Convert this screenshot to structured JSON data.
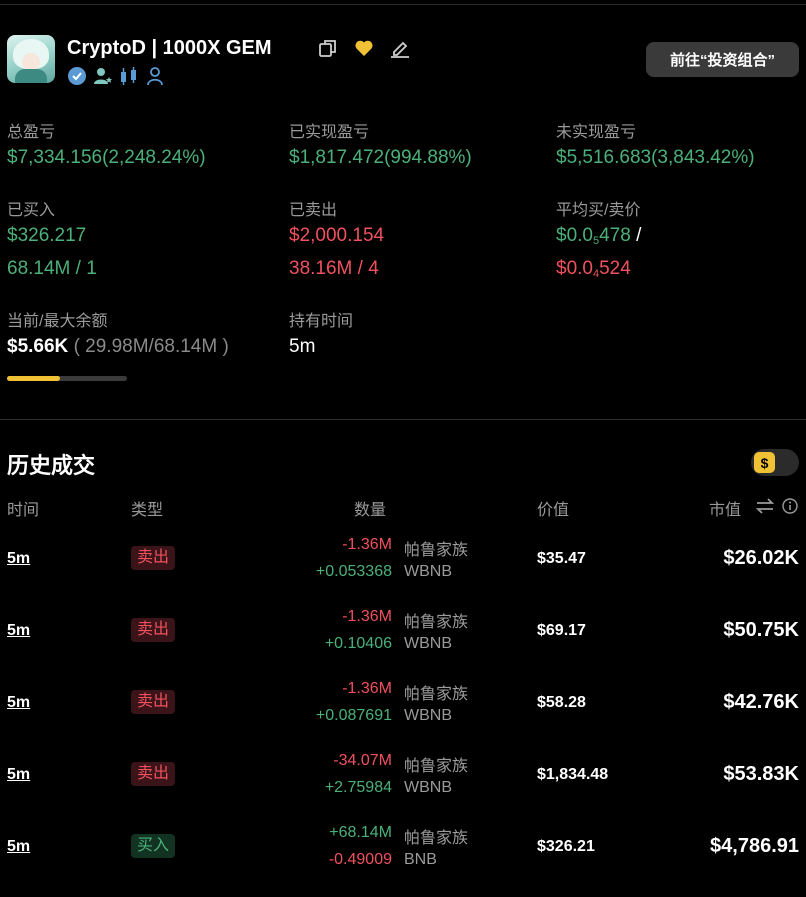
{
  "header": {
    "title": "CryptoD | 1000X GEM",
    "portfolio_button": "前往“投资组合”"
  },
  "stats": {
    "total_pnl": {
      "label": "总盈亏",
      "value": "$7,334.156(2,248.24%)"
    },
    "realized_pnl": {
      "label": "已实现盈亏",
      "value": "$1,817.472(994.88%)"
    },
    "unrealized_pnl": {
      "label": "未实现盈亏",
      "value": "$5,516.683(3,843.42%)"
    },
    "bought": {
      "label": "已买入",
      "amount": "$326.217",
      "qty": "68.14M / 1"
    },
    "sold": {
      "label": "已卖出",
      "amount": "$2,000.154",
      "qty": "38.16M / 4"
    },
    "avg_price": {
      "label": "平均买/卖价",
      "buy_prefix": "$0.0",
      "buy_sub": "5",
      "buy_rest": "478",
      "separator": "/",
      "sell_prefix": "$0.0",
      "sell_sub": "4",
      "sell_rest": "524"
    },
    "balance": {
      "label": "当前/最大余额",
      "value": "$5.66K",
      "detail": "( 29.98M/68.14M )",
      "fill": 0.44
    },
    "hold_time": {
      "label": "持有时间",
      "value": "5m"
    }
  },
  "history": {
    "title": "历史成交",
    "toggle_symbol": "$",
    "columns": {
      "time": "时间",
      "type": "类型",
      "qty": "数量",
      "value": "价值",
      "mcap": "市值"
    },
    "rows": [
      {
        "time": "5m",
        "type": "卖出",
        "qty_top": "-1.36M",
        "token_top": "帕鲁家族",
        "qty_bot": "+0.053368",
        "token_bot": "WBNB",
        "value": "$35.47",
        "mcap": "$26.02K"
      },
      {
        "time": "5m",
        "type": "卖出",
        "qty_top": "-1.36M",
        "token_top": "帕鲁家族",
        "qty_bot": "+0.10406",
        "token_bot": "WBNB",
        "value": "$69.17",
        "mcap": "$50.75K"
      },
      {
        "time": "5m",
        "type": "卖出",
        "qty_top": "-1.36M",
        "token_top": "帕鲁家族",
        "qty_bot": "+0.087691",
        "token_bot": "WBNB",
        "value": "$58.28",
        "mcap": "$42.76K"
      },
      {
        "time": "5m",
        "type": "卖出",
        "qty_top": "-34.07M",
        "token_top": "帕鲁家族",
        "qty_bot": "+2.75984",
        "token_bot": "WBNB",
        "value": "$1,834.48",
        "mcap": "$53.83K"
      },
      {
        "time": "5m",
        "type": "买入",
        "qty_top": "+68.14M",
        "token_top": "帕鲁家族",
        "qty_bot": "-0.49009",
        "token_bot": "BNB",
        "value": "$326.21",
        "mcap": "$4,786.91"
      }
    ]
  },
  "colors": {
    "green": "#4cb07a",
    "red": "#f0515f",
    "accent": "#f0c035",
    "badge_blue": "#5b9bd5",
    "badge_teal": "#7ec8c0"
  },
  "icons": [
    "copy-icon",
    "heart-icon",
    "edit-icon",
    "verified-icon",
    "user-star-icon",
    "candles-icon",
    "user-icon",
    "swap-icon",
    "info-icon"
  ]
}
